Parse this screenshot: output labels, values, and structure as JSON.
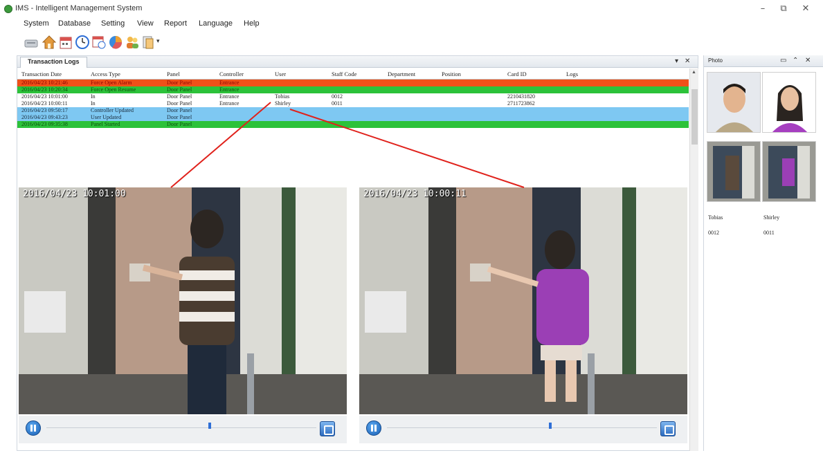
{
  "window": {
    "title": "IMS - Intelligent Management System",
    "minimize": "–",
    "restore": "⧉",
    "close": "✕"
  },
  "menu": [
    "System",
    "Database",
    "Setting",
    "View",
    "Report",
    "Language",
    "Help"
  ],
  "toolbar": {
    "icons": [
      "terminal-icon",
      "home-icon",
      "calendar-icon",
      "clock-icon",
      "schedule-icon",
      "pie-chart-icon",
      "users-icon",
      "document-icon"
    ],
    "dropdown_arrow": "▾"
  },
  "transaction_logs": {
    "tab_label": "Transaction Logs",
    "pin_icon": "▾",
    "close_icon": "✕",
    "columns": [
      "Transaction Date",
      "Access Type",
      "Panel",
      "Controller",
      "User",
      "Staff Code",
      "Department",
      "Position",
      "Card ID",
      "Logs"
    ],
    "rows": [
      {
        "date": "2016/04/23 10:21:46",
        "access": "Force Open Alarm",
        "panel": "Door Panel",
        "controller": "Entrance",
        "user": "",
        "staff": "",
        "dept": "",
        "pos": "",
        "card": "",
        "logs": "",
        "bg": "#f05019",
        "fg": "#8a0000"
      },
      {
        "date": "2016/04/23 10:20:34",
        "access": "Force Open Resume",
        "panel": "Door Panel",
        "controller": "Entrance",
        "user": "",
        "staff": "",
        "dept": "",
        "pos": "",
        "card": "",
        "logs": "",
        "bg": "#2cc23a",
        "fg": "#0b4d0b"
      },
      {
        "date": "2016/04/23 10:01:00",
        "access": "In",
        "panel": "Door Panel",
        "controller": "Entrance",
        "user": "Tobias",
        "staff": "0012",
        "dept": "",
        "pos": "",
        "card": "2210431820",
        "logs": "",
        "bg": "#ffffff",
        "fg": "#222222"
      },
      {
        "date": "2016/04/23 10:00:11",
        "access": "In",
        "panel": "Door Panel",
        "controller": "Entrance",
        "user": "Shirley",
        "staff": "0011",
        "dept": "",
        "pos": "",
        "card": "2711723862",
        "logs": "",
        "bg": "#ffffff",
        "fg": "#222222"
      },
      {
        "date": "2016/04/23 09:50:17",
        "access": "Controller Updated",
        "panel": "Door Panel",
        "controller": "",
        "user": "",
        "staff": "",
        "dept": "",
        "pos": "",
        "card": "",
        "logs": "",
        "bg": "#7ec8f2",
        "fg": "#1a2a3a"
      },
      {
        "date": "2016/04/23 09:43:23",
        "access": "User Updated",
        "panel": "Door Panel",
        "controller": "",
        "user": "",
        "staff": "",
        "dept": "",
        "pos": "",
        "card": "",
        "logs": "",
        "bg": "#7ec8f2",
        "fg": "#1a2a3a"
      },
      {
        "date": "2016/04/23 09:35:38",
        "access": "Panel Started",
        "panel": "Door Panel",
        "controller": "",
        "user": "",
        "staff": "",
        "dept": "",
        "pos": "",
        "card": "",
        "logs": "",
        "bg": "#2cc23a",
        "fg": "#0b4d0b"
      }
    ]
  },
  "videos": [
    {
      "timestamp": "2016/04/23  10:01:00",
      "progress": 0.6
    },
    {
      "timestamp": "2016/04/23  10:00:11",
      "progress": 0.6
    }
  ],
  "photo_panel": {
    "title": "Photo",
    "controls": [
      "▭",
      "⌃",
      "✕"
    ],
    "people": [
      {
        "name": "Tobias",
        "code": "0012"
      },
      {
        "name": "Shirley",
        "code": "0011"
      }
    ]
  },
  "colors": {
    "alarm": "#f05019",
    "green": "#2cc23a",
    "blue": "#7ec8f2",
    "connector": "#e0211b"
  }
}
